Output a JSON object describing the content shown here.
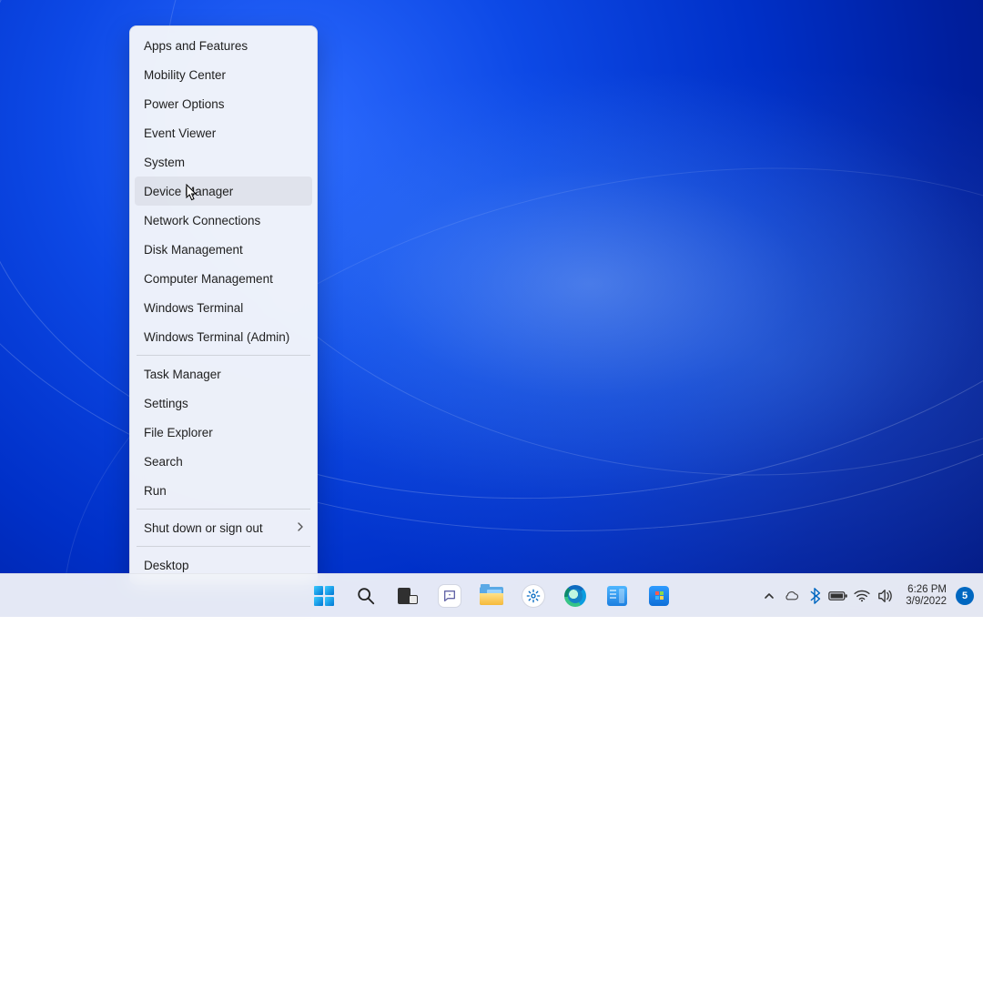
{
  "context_menu": {
    "sections": [
      [
        "Apps and Features",
        "Mobility Center",
        "Power Options",
        "Event Viewer",
        "System",
        "Device Manager",
        "Network Connections",
        "Disk Management",
        "Computer Management",
        "Windows Terminal",
        "Windows Terminal (Admin)"
      ],
      [
        "Task Manager",
        "Settings",
        "File Explorer",
        "Search",
        "Run"
      ],
      [
        "Shut down or sign out"
      ],
      [
        "Desktop"
      ]
    ],
    "hovered_label": "Device Manager",
    "submenu_label": "Shut down or sign out"
  },
  "taskbar": {
    "icons": [
      "start",
      "search",
      "task-view",
      "chat",
      "file-explorer",
      "settings",
      "edge",
      "server-manager",
      "microsoft-store"
    ]
  },
  "systray": {
    "icons": [
      "overflow-chevron",
      "onedrive",
      "bluetooth",
      "battery",
      "wifi",
      "volume"
    ],
    "time": "6:26 PM",
    "date": "3/9/2022",
    "notification_count": "5"
  }
}
